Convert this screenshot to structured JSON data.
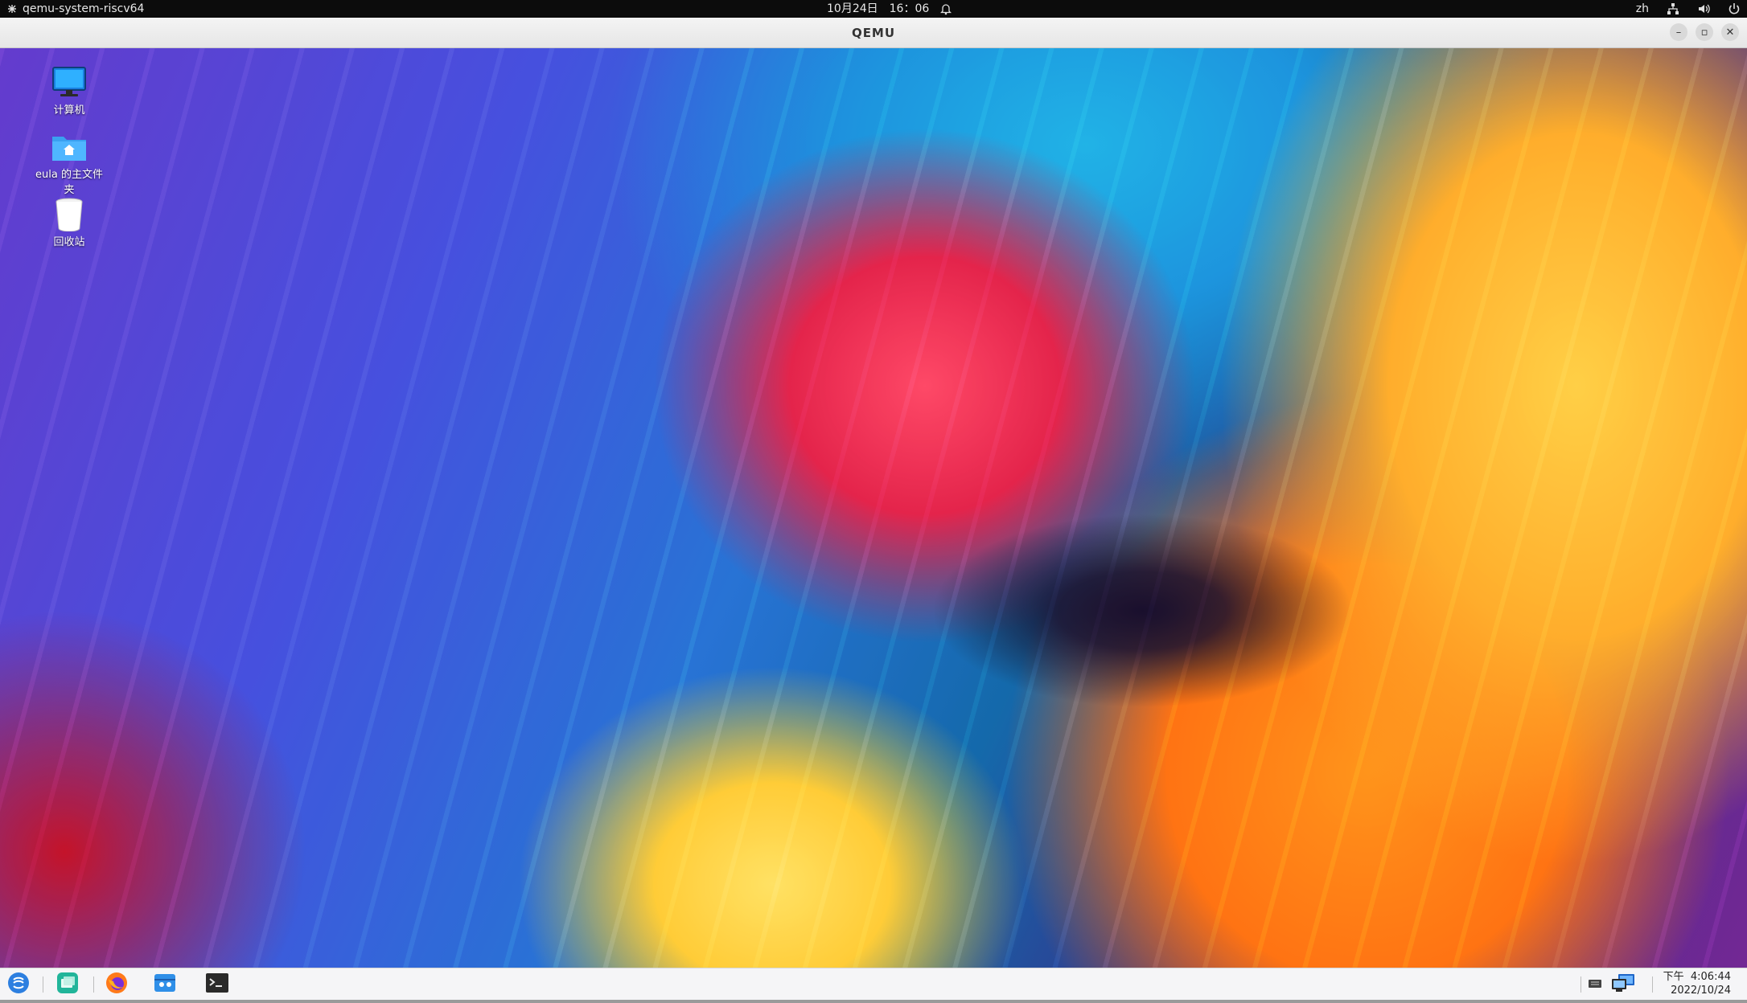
{
  "host_bar": {
    "app_name": "qemu-system-riscv64",
    "date": "10月24日",
    "time": "16：06",
    "lang": "zh"
  },
  "window": {
    "title": "QEMU",
    "minimize": "–",
    "restore": "▫",
    "close": "✕"
  },
  "desktop": {
    "icons": [
      {
        "label": "计算机",
        "icon": "computer-icon"
      },
      {
        "label": "eula 的主文件夹",
        "icon": "home-folder-icon"
      },
      {
        "label": "回收站",
        "icon": "trash-icon"
      }
    ]
  },
  "taskbar": {
    "period": "下午",
    "time": "4:06:44",
    "date": "2022/10/24",
    "launchers": [
      "start-menu-icon",
      "multitask-view-icon",
      "firefox-icon",
      "file-manager-icon",
      "terminal-icon"
    ]
  },
  "colors": {
    "host_bar_bg": "#0c0c0c",
    "titlebar_bg": "#ececec",
    "taskbar_bg": "#f5f5f7",
    "accent_blue": "#2d9cf0"
  }
}
